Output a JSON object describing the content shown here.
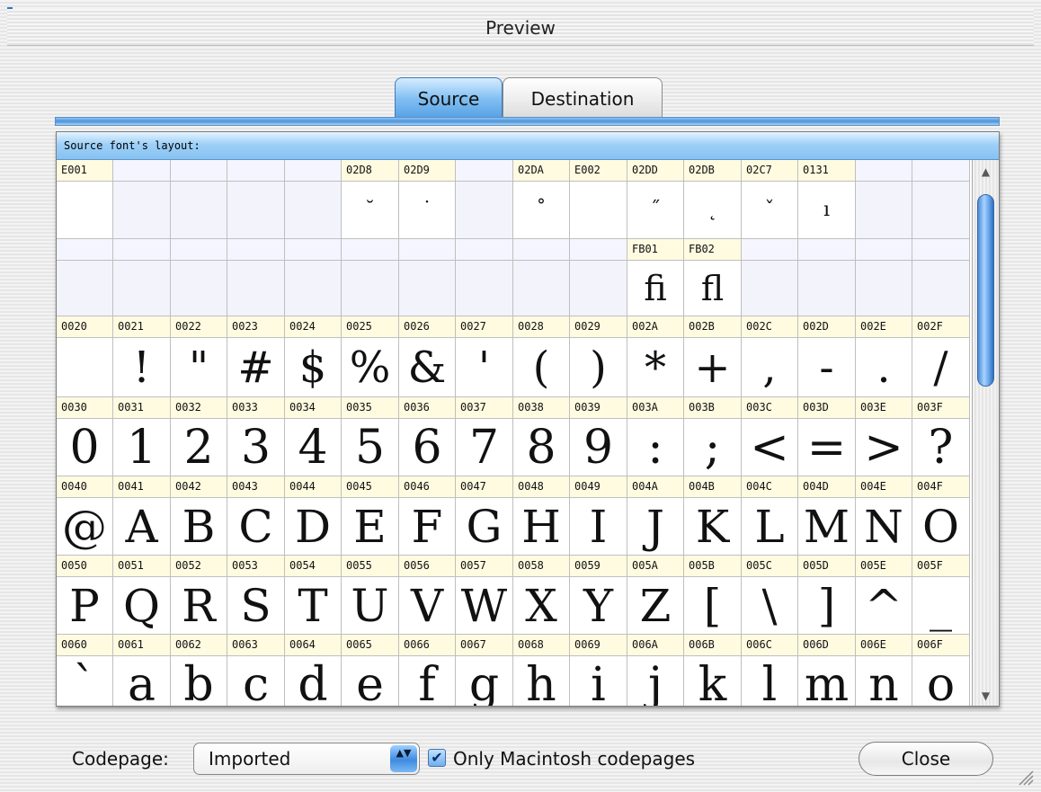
{
  "window": {
    "title": "Preview"
  },
  "tabs": [
    {
      "label": "Source",
      "active": true
    },
    {
      "label": "Destination",
      "active": false
    }
  ],
  "panel": {
    "header": "Source font's layout:"
  },
  "grid": {
    "rows": [
      {
        "codes": [
          "E001",
          "",
          "",
          "",
          "",
          "02D8",
          "02D9",
          "",
          "02DA",
          "E002",
          "02DD",
          "02DB",
          "02C7",
          "0131",
          "",
          ""
        ],
        "glyphs": [
          "",
          "",
          "",
          "",
          "",
          "˘",
          "˙",
          "",
          "˚",
          "",
          "˝",
          "˛",
          "ˇ",
          "ı",
          "",
          ""
        ]
      },
      {
        "codes": [
          "",
          "",
          "",
          "",
          "",
          "",
          "",
          "",
          "",
          "",
          "FB01",
          "FB02",
          "",
          "",
          "",
          ""
        ],
        "glyphs": [
          "",
          "",
          "",
          "",
          "",
          "",
          "",
          "",
          "",
          "",
          "ﬁ",
          "ﬂ",
          "",
          "",
          "",
          ""
        ]
      },
      {
        "codes": [
          "0020",
          "0021",
          "0022",
          "0023",
          "0024",
          "0025",
          "0026",
          "0027",
          "0028",
          "0029",
          "002A",
          "002B",
          "002C",
          "002D",
          "002E",
          "002F"
        ],
        "glyphs": [
          " ",
          "!",
          "\"",
          "#",
          "$",
          "%",
          "&",
          "'",
          "(",
          ")",
          "*",
          "+",
          ",",
          "-",
          ".",
          "/"
        ]
      },
      {
        "codes": [
          "0030",
          "0031",
          "0032",
          "0033",
          "0034",
          "0035",
          "0036",
          "0037",
          "0038",
          "0039",
          "003A",
          "003B",
          "003C",
          "003D",
          "003E",
          "003F"
        ],
        "glyphs": [
          "0",
          "1",
          "2",
          "3",
          "4",
          "5",
          "6",
          "7",
          "8",
          "9",
          ":",
          ";",
          "<",
          "=",
          ">",
          "?"
        ]
      },
      {
        "codes": [
          "0040",
          "0041",
          "0042",
          "0043",
          "0044",
          "0045",
          "0046",
          "0047",
          "0048",
          "0049",
          "004A",
          "004B",
          "004C",
          "004D",
          "004E",
          "004F"
        ],
        "glyphs": [
          "@",
          "A",
          "B",
          "C",
          "D",
          "E",
          "F",
          "G",
          "H",
          "I",
          "J",
          "K",
          "L",
          "M",
          "N",
          "O"
        ]
      },
      {
        "codes": [
          "0050",
          "0051",
          "0052",
          "0053",
          "0054",
          "0055",
          "0056",
          "0057",
          "0058",
          "0059",
          "005A",
          "005B",
          "005C",
          "005D",
          "005E",
          "005F"
        ],
        "glyphs": [
          "P",
          "Q",
          "R",
          "S",
          "T",
          "U",
          "V",
          "W",
          "X",
          "Y",
          "Z",
          "[",
          "\\",
          "]",
          "^",
          "_"
        ]
      },
      {
        "codes": [
          "0060",
          "0061",
          "0062",
          "0063",
          "0064",
          "0065",
          "0066",
          "0067",
          "0068",
          "0069",
          "006A",
          "006B",
          "006C",
          "006D",
          "006E",
          "006F"
        ],
        "glyphs": [
          "`",
          "a",
          "b",
          "c",
          "d",
          "e",
          "f",
          "g",
          "h",
          "i",
          "j",
          "k",
          "l",
          "m",
          "n",
          "o"
        ]
      }
    ]
  },
  "scrollbar": {
    "up_icon": "▲",
    "down_icon": "▼"
  },
  "footer": {
    "codepage_label": "Codepage:",
    "codepage_value": "Imported",
    "popup_icon": "▲▼",
    "checkbox_checked": true,
    "checkbox_mark": "✔",
    "checkbox_label": "Only Macintosh codepages",
    "close_label": "Close"
  },
  "colors": {
    "accent": "#5aa3e6",
    "code_cell": "#fffbe0",
    "grid_line": "#bfbfbf"
  }
}
